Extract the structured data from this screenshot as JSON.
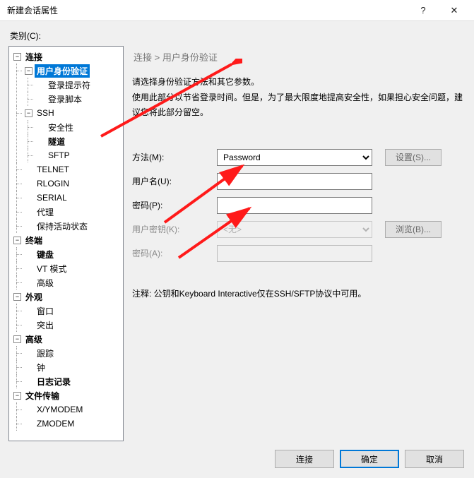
{
  "window": {
    "title": "新建会话属性",
    "help_icon": "?",
    "close_icon": "✕"
  },
  "category_label": "类别(C):",
  "tree": {
    "connection": "连接",
    "user_auth": "用户身份验证",
    "login_prompt": "登录提示符",
    "login_script": "登录脚本",
    "ssh": "SSH",
    "security": "安全性",
    "tunnel": "隧道",
    "sftp": "SFTP",
    "telnet": "TELNET",
    "rlogin": "RLOGIN",
    "serial": "SERIAL",
    "proxy": "代理",
    "keepalive": "保持活动状态",
    "terminal": "终端",
    "keyboard": "键盘",
    "vtmode": "VT 模式",
    "advanced_t": "高级",
    "appearance": "外观",
    "window": "窗口",
    "highlight": "突出",
    "advanced": "高级",
    "trace": "跟踪",
    "bell": "钟",
    "logging": "日志记录",
    "file_transfer": "文件传输",
    "xymodem": "X/YMODEM",
    "zmodem": "ZMODEM"
  },
  "breadcrumb": "连接 > 用户身份验证",
  "desc_line1": "请选择身份验证方法和其它参数。",
  "desc_line2": "使用此部分以节省登录时间。但是，为了最大限度地提高安全性，如果担心安全问题，建议您将此部分留空。",
  "form": {
    "method_label": "方法(M):",
    "method_value": "Password",
    "settings_btn": "设置(S)...",
    "username_label": "用户名(U):",
    "username_value": "",
    "password_label": "密码(P):",
    "password_value": "",
    "userkey_label": "用户密钥(K):",
    "userkey_value": "<无>",
    "browse_btn": "浏览(B)...",
    "password2_label": "密码(A):",
    "password2_value": ""
  },
  "note": "注释: 公钥和Keyboard Interactive仅在SSH/SFTP协议中可用。",
  "buttons": {
    "connect": "连接",
    "ok": "确定",
    "cancel": "取消"
  }
}
